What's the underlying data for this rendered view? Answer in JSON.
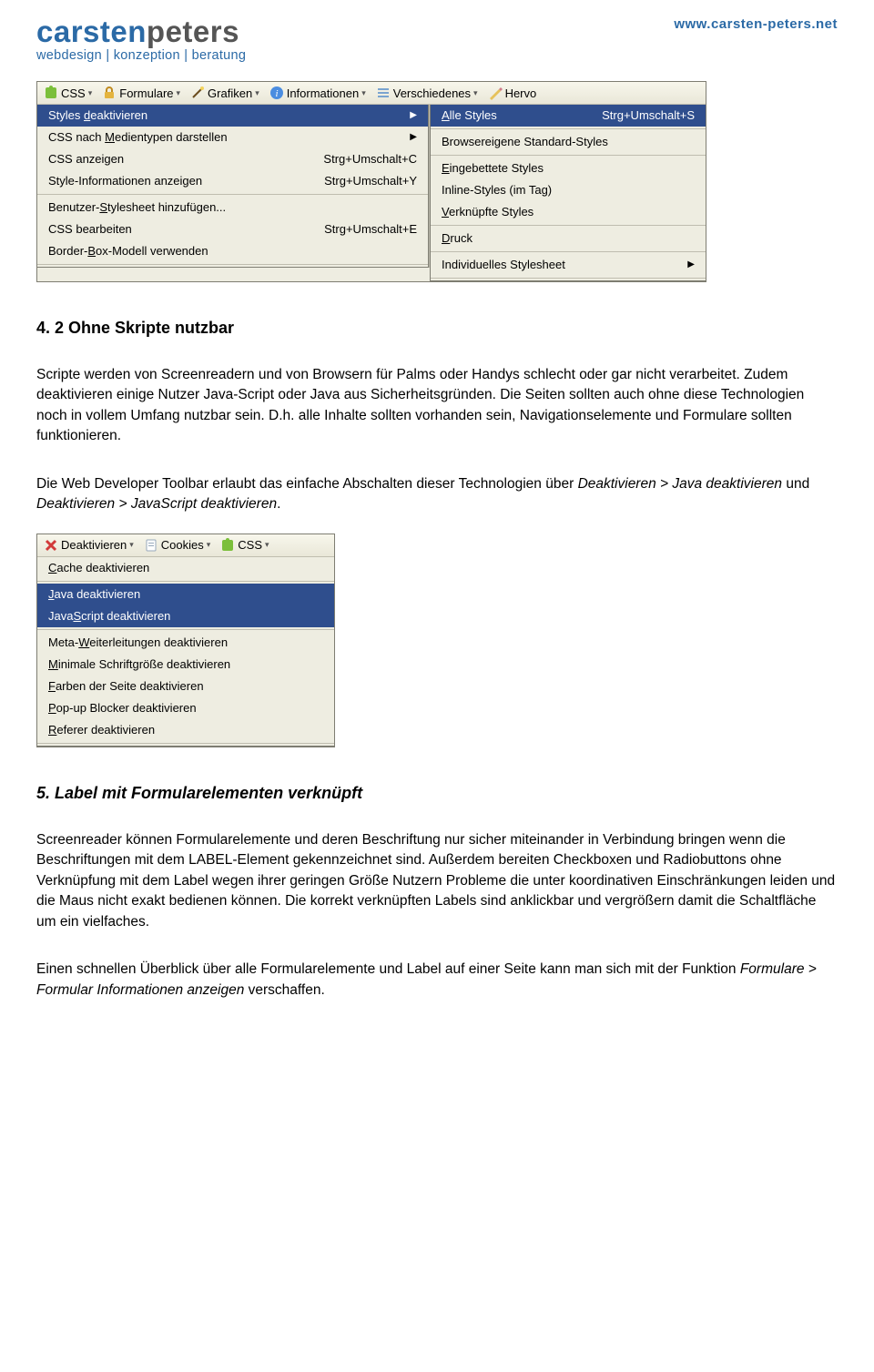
{
  "header": {
    "logo_carsten": "carsten",
    "logo_peters": "peters",
    "tagline": "webdesign | konzeption | beratung",
    "url": "www.carsten-peters.net"
  },
  "toolbar1": {
    "items": [
      "CSS",
      "Formulare",
      "Grafiken",
      "Informationen",
      "Verschiedenes",
      "Hervo"
    ]
  },
  "menu_left": {
    "rows": [
      {
        "label": "Styles deaktivieren",
        "shortcut": "",
        "arrow": true,
        "highlight": true,
        "u": 7
      },
      {
        "label": "CSS nach Medientypen darstellen",
        "shortcut": "",
        "arrow": true,
        "highlight": false,
        "u": 9
      },
      {
        "label": "CSS anzeigen",
        "shortcut": "Strg+Umschalt+C",
        "arrow": false,
        "highlight": false,
        "u": -1
      },
      {
        "label": "Style-Informationen anzeigen",
        "shortcut": "Strg+Umschalt+Y",
        "arrow": false,
        "highlight": false,
        "u": -1
      },
      {
        "sep": true
      },
      {
        "label": "Benutzer-Stylesheet hinzufügen...",
        "shortcut": "",
        "arrow": false,
        "highlight": false,
        "u": 9
      },
      {
        "label": "CSS bearbeiten",
        "shortcut": "Strg+Umschalt+E",
        "arrow": false,
        "highlight": false,
        "u": -1
      },
      {
        "label": "Border-Box-Modell verwenden",
        "shortcut": "",
        "arrow": false,
        "highlight": false,
        "u": 7
      },
      {
        "sep": true
      }
    ]
  },
  "menu_right": {
    "rows": [
      {
        "label": "Alle Styles",
        "shortcut": "Strg+Umschalt+S",
        "highlight": true,
        "u": 0
      },
      {
        "sep": true
      },
      {
        "label": "Browsereigene Standard-Styles",
        "u": -1
      },
      {
        "sep": true
      },
      {
        "label": "Eingebettete Styles",
        "u": 0
      },
      {
        "label": "Inline-Styles (im Tag)",
        "u": -1
      },
      {
        "label": "Verknüpfte Styles",
        "u": 0
      },
      {
        "sep": true
      },
      {
        "label": "Druck",
        "u": 0
      },
      {
        "sep": true
      },
      {
        "label": "Individuelles Stylesheet",
        "arrow": true,
        "u": -1
      },
      {
        "sep": true
      }
    ]
  },
  "section42": {
    "heading": "4. 2   Ohne Skripte nutzbar",
    "p1": "Scripte werden von Screenreadern und von Browsern für Palms oder Handys schlecht oder gar nicht verarbeitet. Zudem deaktivieren einige Nutzer Java-Script oder Java aus Sicherheitsgründen. Die Seiten sollten auch ohne diese Technologien noch in vollem Umfang nutzbar sein. D.h. alle Inhalte sollten vorhanden sein, Navigationselemente und Formulare sollten funktionieren.",
    "p2a": "Die Web Developer Toolbar erlaubt das einfache Abschalten dieser Technologien über ",
    "p2_em1": "Deaktivieren > Java deaktivieren",
    "p2b": " und ",
    "p2_em2": "Deaktivieren > JavaScript deaktivieren",
    "p2c": "."
  },
  "toolbar2": {
    "items": [
      "Deaktivieren",
      "Cookies",
      "CSS"
    ]
  },
  "menu2": {
    "rows": [
      {
        "label": "Cache deaktivieren",
        "u": 0
      },
      {
        "sep": true
      },
      {
        "label": "Java deaktivieren",
        "highlight": true,
        "u": 0
      },
      {
        "label": "JavaScript deaktivieren",
        "highlight": true,
        "u": 4
      },
      {
        "sep": true
      },
      {
        "label": "Meta-Weiterleitungen deaktivieren",
        "u": 5
      },
      {
        "label": "Minimale Schriftgröße deaktivieren",
        "u": 0
      },
      {
        "label": "Farben der Seite deaktivieren",
        "u": 0
      },
      {
        "label": "Pop-up Blocker deaktivieren",
        "u": 0
      },
      {
        "label": "Referer deaktivieren",
        "u": 0
      },
      {
        "sep": true
      }
    ]
  },
  "section5": {
    "heading": "5.     Label mit Formularelementen verknüpft",
    "p1": "Screenreader können Formularelemente und deren Beschriftung nur sicher miteinander in Verbindung bringen wenn die Beschriftungen mit dem LABEL-Element gekennzeichnet sind. Außerdem bereiten Checkboxen und Radiobuttons ohne Verknüpfung mit dem Label wegen ihrer geringen Größe Nutzern Probleme die unter koordinativen Einschränkungen leiden und die Maus nicht exakt bedienen können. Die korrekt verknüpften Labels sind anklickbar und vergrößern damit die Schaltfläche um ein vielfaches.",
    "p2a": "Einen schnellen Überblick über alle Formularelemente und Label auf einer Seite kann man sich mit der Funktion ",
    "p2_em": "Formulare > Formular Informationen anzeigen",
    "p2b": " verschaffen."
  }
}
